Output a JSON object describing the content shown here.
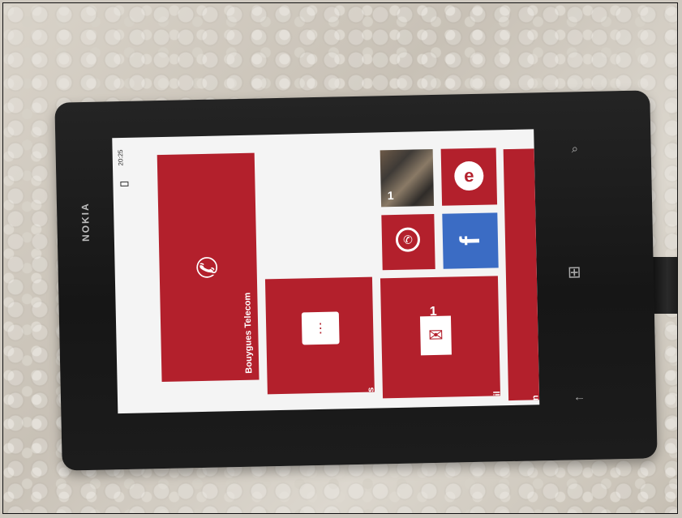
{
  "device": {
    "brand": "NOKIA"
  },
  "status_bar": {
    "time": "20:25"
  },
  "tiles": [
    {
      "label": "Bouygues Telecom",
      "icon": "phone-icon"
    },
    {
      "label": "Messages",
      "icon": "message-icon"
    },
    {
      "label": "Google Mail",
      "icon": "mail-icon",
      "badge": "1"
    },
    {
      "label": "Ramadan",
      "icon": "calendar-icon"
    },
    {
      "label": "",
      "icon": "photos-tile",
      "badge": "1"
    },
    {
      "label": "",
      "icon": "internet-explorer-icon"
    },
    {
      "label": "",
      "icon": "whatsapp-icon"
    },
    {
      "label": "",
      "icon": "facebook-icon"
    }
  ],
  "hardware_buttons": {
    "back": "←",
    "windows": "⊞",
    "search": "⌕"
  },
  "colors": {
    "accent": "#b3202c",
    "facebook": "#3b6cc4",
    "screen_bg": "#f4f4f4",
    "phone_body": "#1a1a1a"
  }
}
